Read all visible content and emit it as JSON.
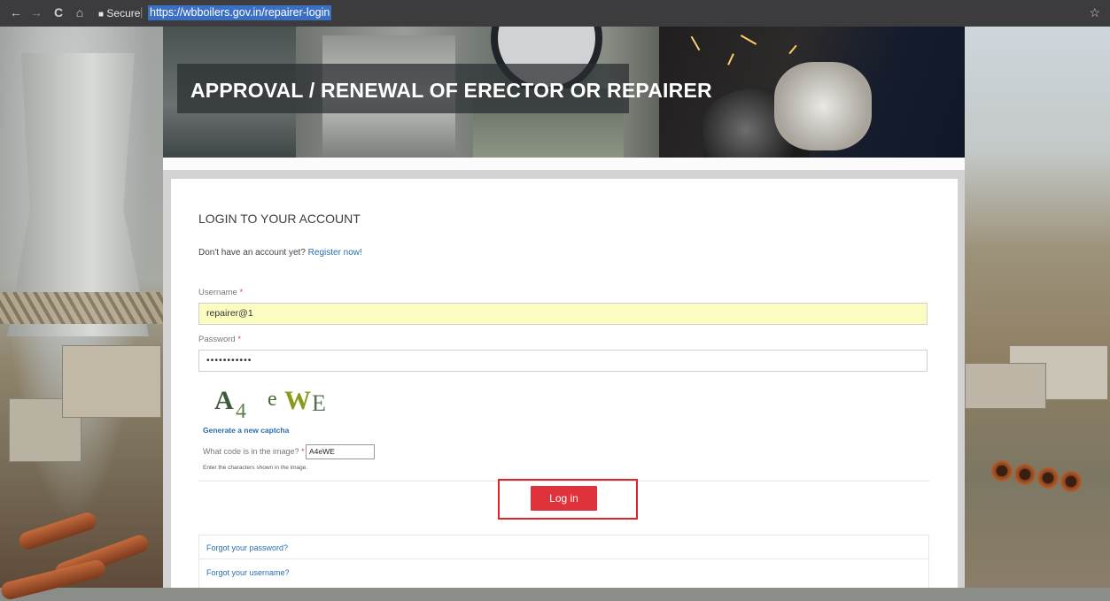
{
  "browser": {
    "back": "←",
    "forward": "→",
    "reload": "C",
    "home": "⌂",
    "secure_label": "Secure",
    "url": "https://wbboilers.gov.in/repairer-login",
    "bookmark": "☆"
  },
  "banner": {
    "title": "APPROVAL / RENEWAL OF ERECTOR OR REPAIRER"
  },
  "login": {
    "heading": "LOGIN TO YOUR ACCOUNT",
    "no_account_text": "Don't have an account yet?",
    "register_link": "Register now!",
    "username_label": "Username",
    "username_value": "repairer@1",
    "password_label": "Password",
    "password_value": "•••••••••••",
    "required_marker": "*",
    "captcha_text": "A4 eWE",
    "generate_captcha": "Generate a new captcha",
    "captcha_question": "What code is in the image?",
    "captcha_value": "A4eWE",
    "captcha_hint": "Enter the characters shown in the image.",
    "login_button": "Log in",
    "forgot_password": "Forgot your password?",
    "forgot_username": "Forgot your username?"
  },
  "colors": {
    "accent_red": "#e0323a",
    "link_blue": "#2a6db0",
    "highlight_border": "#d9252b"
  }
}
